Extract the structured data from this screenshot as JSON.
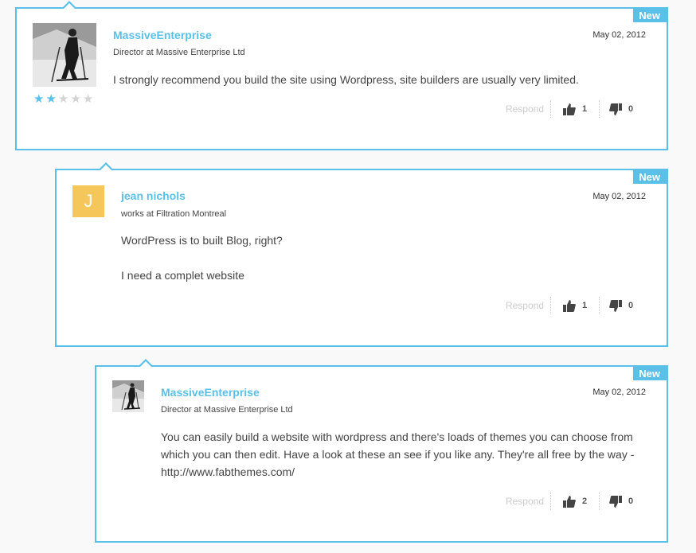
{
  "comments": [
    {
      "badge": "New",
      "author": "MassiveEnterprise",
      "title": "Director at Massive Enterprise Ltd",
      "date": "May 02, 2012",
      "paragraphs": [
        "I strongly recommend you build the site using Wordpress, site builders are usually very limited."
      ],
      "rating": 2,
      "rating_max": 5,
      "respond_label": "Respond",
      "likes": "1",
      "dislikes": "0",
      "avatar": "skier-photo"
    },
    {
      "badge": "New",
      "author": "jean nichols",
      "title": "works at Filtration Montreal",
      "date": "May 02, 2012",
      "paragraphs": [
        "WordPress is to built Blog, right?",
        "I need a complet website"
      ],
      "respond_label": "Respond",
      "likes": "1",
      "dislikes": "0",
      "avatar_letter": "J",
      "avatar_color": "#f5c75a"
    },
    {
      "badge": "New",
      "author": "MassiveEnterprise",
      "title": "Director at Massive Enterprise Ltd",
      "date": "May 02, 2012",
      "paragraphs": [
        "You can easily build a website with wordpress and there's loads of themes you can choose from which you can then edit. Have a look at these an see if you like any. They're all free by the way - http://www.fabthemes.com/"
      ],
      "respond_label": "Respond",
      "likes": "2",
      "dislikes": "0",
      "avatar": "skier-photo"
    }
  ],
  "colors": {
    "accent": "#5bc0e8",
    "letter_avatar": "#f5c75a"
  }
}
